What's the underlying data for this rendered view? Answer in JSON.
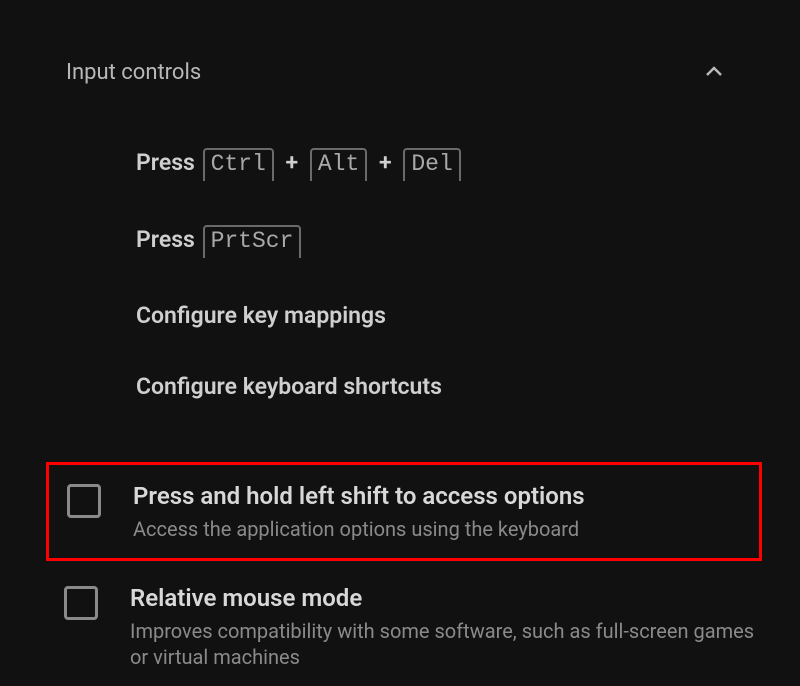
{
  "section": {
    "title": "Input controls"
  },
  "items": {
    "press_cad": {
      "label": "Press ",
      "key1": "Ctrl",
      "key2": "Alt",
      "key3": "Del"
    },
    "press_prtscr": {
      "label": "Press ",
      "key1": "PrtScr"
    },
    "config_keymap": {
      "label": "Configure key mappings"
    },
    "config_shortcuts": {
      "label": "Configure keyboard shortcuts"
    }
  },
  "checks": {
    "shift_options": {
      "title": "Press and hold left shift to access options",
      "desc": "Access the application options using the keyboard"
    },
    "relative_mouse": {
      "title": "Relative mouse mode",
      "desc": "Improves compatibility with some software, such as full-screen games or virtual machines"
    }
  },
  "plus": " + "
}
